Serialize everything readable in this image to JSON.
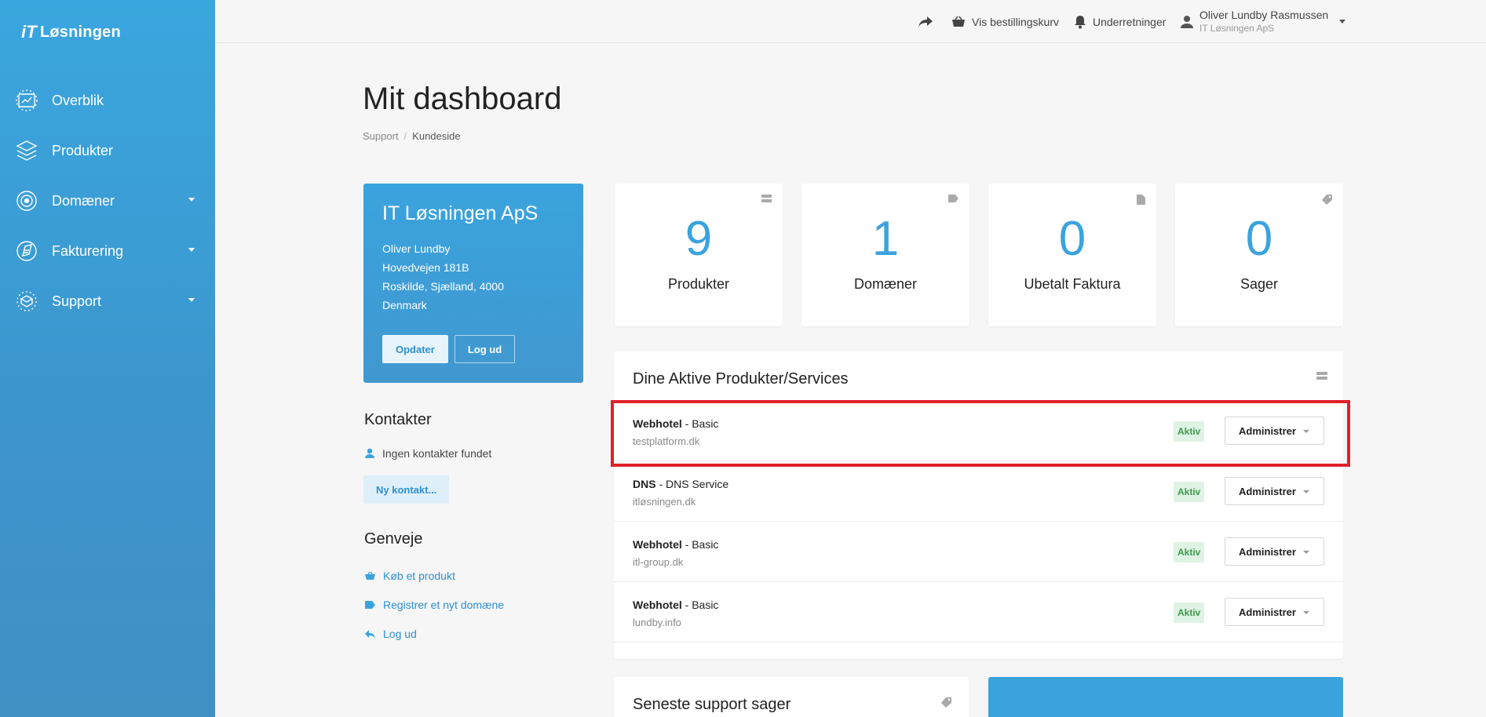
{
  "brand": {
    "name": "Løsningen",
    "mark": "iT"
  },
  "sidebar": {
    "items": [
      {
        "label": "Overblik",
        "icon": "dashboard-icon",
        "has_caret": false
      },
      {
        "label": "Produkter",
        "icon": "box-icon",
        "has_caret": false
      },
      {
        "label": "Domæner",
        "icon": "globe-icon",
        "has_caret": true
      },
      {
        "label": "Fakturering",
        "icon": "invoice-icon",
        "has_caret": true
      },
      {
        "label": "Support",
        "icon": "support-icon",
        "has_caret": true
      }
    ]
  },
  "topbar": {
    "cart_label": "Vis bestillingskurv",
    "notifications_label": "Underretninger",
    "user_name": "Oliver Lundby Rasmussen",
    "user_company": "IT Løsningen ApS"
  },
  "header": {
    "title": "Mit dashboard",
    "breadcrumb": [
      "Support",
      "Kundeside"
    ]
  },
  "company": {
    "name": "IT Løsningen ApS",
    "contact": "Oliver Lundby",
    "street": "Hovedvejen 181B",
    "city": "Roskilde, Sjælland, 4000",
    "country": "Denmark",
    "update_label": "Opdater",
    "logout_label": "Log ud"
  },
  "contacts": {
    "title": "Kontakter",
    "empty_text": "Ingen kontakter fundet",
    "new_label": "Ny kontakt..."
  },
  "shortcuts": {
    "title": "Genveje",
    "items": [
      {
        "label": "Køb et produkt",
        "icon": "basket-icon"
      },
      {
        "label": "Registrer et nyt domæne",
        "icon": "tag-icon"
      },
      {
        "label": "Log ud",
        "icon": "reply-icon"
      }
    ]
  },
  "stats": [
    {
      "value": "9",
      "label": "Produkter",
      "icon": "server-icon"
    },
    {
      "value": "1",
      "label": "Domæner",
      "icon": "tag-icon"
    },
    {
      "value": "0",
      "label": "Ubetalt Faktura",
      "icon": "file-icon"
    },
    {
      "value": "0",
      "label": "Sager",
      "icon": "ticket-icon"
    }
  ],
  "products": {
    "title": "Dine Aktive Produkter/Services",
    "rows": [
      {
        "product": "Webhotel",
        "plan": " - Basic",
        "domain": "testplatform.dk",
        "status": "Aktiv",
        "action": "Administrer"
      },
      {
        "product": "DNS",
        "plan": " - DNS Service",
        "domain": "itløsningen.dk",
        "status": "Aktiv",
        "action": "Administrer"
      },
      {
        "product": "Webhotel",
        "plan": " - Basic",
        "domain": "itl-group.dk",
        "status": "Aktiv",
        "action": "Administrer"
      },
      {
        "product": "Webhotel",
        "plan": " - Basic",
        "domain": "lundby.info",
        "status": "Aktiv",
        "action": "Administrer"
      }
    ]
  },
  "support": {
    "title": "Seneste support sager"
  },
  "colors": {
    "accent": "#3aa3de",
    "highlight": "#e0202a",
    "status_active": "#3a9b4a"
  }
}
